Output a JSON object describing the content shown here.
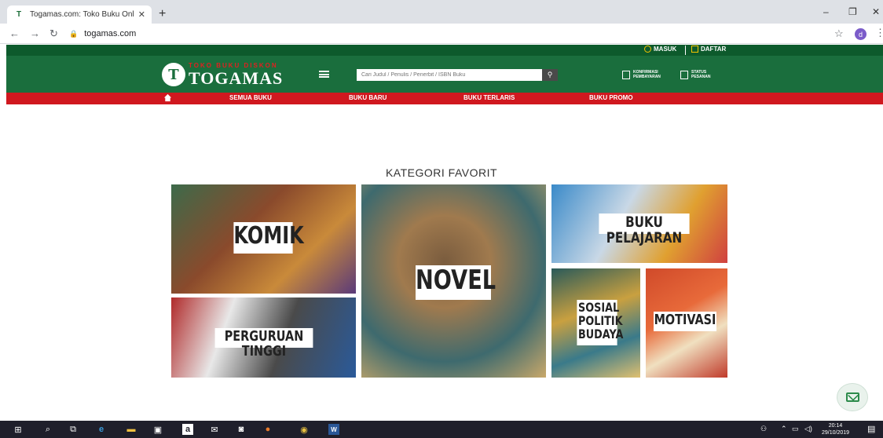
{
  "browser": {
    "tab_title": "Togamas.com: Toko Buku Online",
    "tab_close": "✕",
    "new_tab": "+",
    "url": "togamas.com",
    "profile_initial": "d"
  },
  "site": {
    "login": "MASUK",
    "register": "DAFTAR",
    "logo_tagline": "TOKO BUKU DISKON",
    "logo_name": "TOGAMAS",
    "search_placeholder": "Cari Judul / Penulis / Penerbit / ISBN Buku",
    "confirm_label_1": "KONFIRMASI",
    "confirm_label_2": "PEMBAYARAN",
    "status_label_1": "STATUS",
    "status_label_2": "PESANAN",
    "menu": [
      "SEMUA BUKU",
      "BUKU BARU",
      "BUKU TERLARIS",
      "BUKU PROMO"
    ]
  },
  "content": {
    "section_title": "KATEGORI FAVORIT",
    "categories": [
      "KOMIK",
      "NOVEL",
      "BUKU PELAJARAN",
      "PERGURUAN TINGGI",
      "SOSIAL\nPOLITIK\nBUDAYA",
      "MOTIVASI"
    ]
  },
  "taskbar": {
    "time": "20:14",
    "date": "29/10/2019"
  },
  "colors": {
    "header_green": "#1a6e3d",
    "top_strip": "#0d5a2c",
    "menu_red": "#d0181f"
  }
}
